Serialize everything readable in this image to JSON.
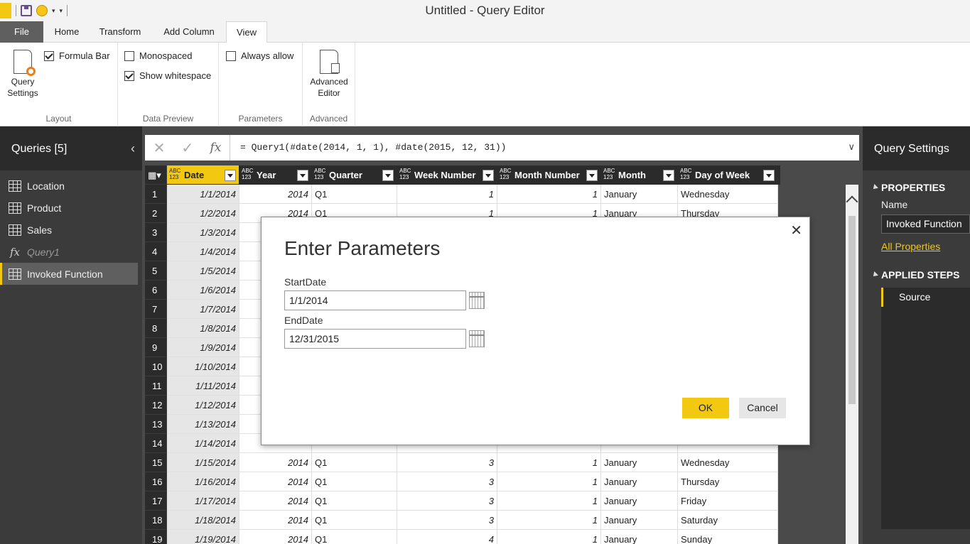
{
  "window": {
    "title": "Untitled - Query Editor"
  },
  "ribbon": {
    "tabs": [
      "File",
      "Home",
      "Transform",
      "Add Column",
      "View"
    ],
    "active_tab": "View",
    "groups": {
      "layout": {
        "label": "Layout",
        "query_settings": [
          "Query",
          "Settings"
        ],
        "formula_bar": "Formula Bar",
        "formula_bar_checked": true
      },
      "data_preview": {
        "label": "Data Preview",
        "monospaced": "Monospaced",
        "monospaced_checked": false,
        "show_whitespace": "Show whitespace",
        "show_whitespace_checked": true
      },
      "parameters": {
        "label": "Parameters",
        "always_allow": "Always allow",
        "always_allow_checked": false
      },
      "advanced": {
        "label": "Advanced",
        "advanced_editor": [
          "Advanced",
          "Editor"
        ]
      }
    }
  },
  "queries_pane": {
    "title": "Queries [5]",
    "items": [
      {
        "label": "Location",
        "icon": "table-icon"
      },
      {
        "label": "Product",
        "icon": "table-icon"
      },
      {
        "label": "Sales",
        "icon": "table-icon"
      },
      {
        "label": "Query1",
        "icon": "function-icon"
      },
      {
        "label": "Invoked Function",
        "icon": "table-icon",
        "selected": true
      }
    ]
  },
  "formula_bar": {
    "formula": "= Query1(#date(2014, 1, 1), #date(2015, 12, 31))"
  },
  "grid": {
    "type_label": "ABC\n123",
    "columns": [
      "Date",
      "Year",
      "Quarter",
      "Week Number",
      "Month Number",
      "Month",
      "Day of Week"
    ],
    "rows": [
      [
        "1",
        "1/1/2014",
        "2014",
        "Q1",
        "1",
        "1",
        "January",
        "Wednesday"
      ],
      [
        "2",
        "1/2/2014",
        "2014",
        "Q1",
        "1",
        "1",
        "January",
        "Thursday"
      ],
      [
        "3",
        "1/3/2014",
        "",
        "",
        "",
        "",
        "",
        ""
      ],
      [
        "4",
        "1/4/2014",
        "",
        "",
        "",
        "",
        "",
        ""
      ],
      [
        "5",
        "1/5/2014",
        "",
        "",
        "",
        "",
        "",
        ""
      ],
      [
        "6",
        "1/6/2014",
        "",
        "",
        "",
        "",
        "",
        ""
      ],
      [
        "7",
        "1/7/2014",
        "",
        "",
        "",
        "",
        "",
        ""
      ],
      [
        "8",
        "1/8/2014",
        "",
        "",
        "",
        "",
        "",
        ""
      ],
      [
        "9",
        "1/9/2014",
        "",
        "",
        "",
        "",
        "",
        ""
      ],
      [
        "10",
        "1/10/2014",
        "",
        "",
        "",
        "",
        "",
        ""
      ],
      [
        "11",
        "1/11/2014",
        "",
        "",
        "",
        "",
        "",
        ""
      ],
      [
        "12",
        "1/12/2014",
        "",
        "",
        "",
        "",
        "",
        ""
      ],
      [
        "13",
        "1/13/2014",
        "",
        "",
        "",
        "",
        "",
        ""
      ],
      [
        "14",
        "1/14/2014",
        "",
        "",
        "",
        "",
        "",
        ""
      ],
      [
        "15",
        "1/15/2014",
        "2014",
        "Q1",
        "3",
        "1",
        "January",
        "Wednesday"
      ],
      [
        "16",
        "1/16/2014",
        "2014",
        "Q1",
        "3",
        "1",
        "January",
        "Thursday"
      ],
      [
        "17",
        "1/17/2014",
        "2014",
        "Q1",
        "3",
        "1",
        "January",
        "Friday"
      ],
      [
        "18",
        "1/18/2014",
        "2014",
        "Q1",
        "3",
        "1",
        "January",
        "Saturday"
      ],
      [
        "19",
        "1/19/2014",
        "2014",
        "Q1",
        "4",
        "1",
        "January",
        "Sunday"
      ]
    ]
  },
  "settings_pane": {
    "title": "Query Settings",
    "properties_header": "PROPERTIES",
    "name_label": "Name",
    "name_value": "Invoked Function",
    "all_properties": "All Properties",
    "applied_steps_header": "APPLIED STEPS",
    "steps": [
      "Source"
    ]
  },
  "dialog": {
    "title": "Enter Parameters",
    "start_label": "StartDate",
    "start_value": "1/1/2014",
    "end_label": "EndDate",
    "end_value": "12/31/2015",
    "ok": "OK",
    "cancel": "Cancel",
    "close": "✕"
  },
  "colors": {
    "accent": "#f2c811",
    "pane_bg": "#3b3b3b",
    "header_bg": "#2b2b2b"
  }
}
